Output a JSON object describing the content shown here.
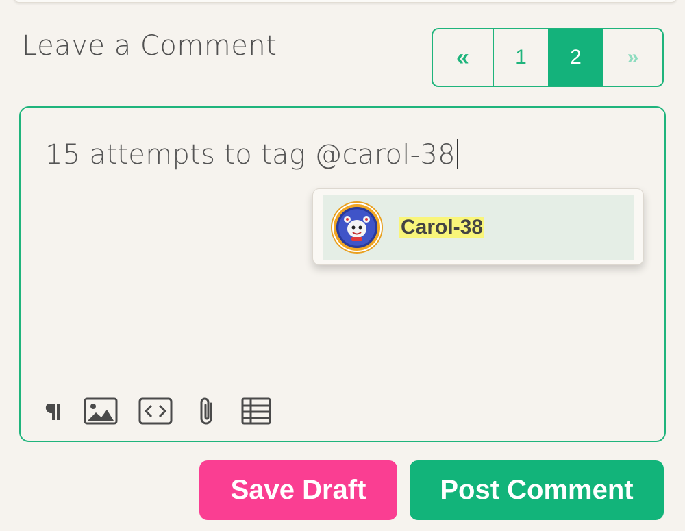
{
  "section": {
    "heading": "Leave a Comment"
  },
  "pagination": {
    "prev": "«",
    "pages": [
      "1",
      "2"
    ],
    "current": "2",
    "next": "»"
  },
  "editor": {
    "text": "15 attempts to tag @carol-38",
    "toolbar": [
      "paragraph-icon",
      "image-icon",
      "code-icon",
      "paperclip-icon",
      "table-icon"
    ]
  },
  "mention_dropdown": {
    "items": [
      {
        "name": "Carol-38",
        "avatar": "cartoon-avatar",
        "highlighted": true
      }
    ]
  },
  "actions": {
    "save_draft": "Save Draft",
    "post_comment": "Post Comment"
  },
  "colors": {
    "accent": "#14b27b",
    "draft": "#fa3e92",
    "highlight": "#f9f57a"
  }
}
